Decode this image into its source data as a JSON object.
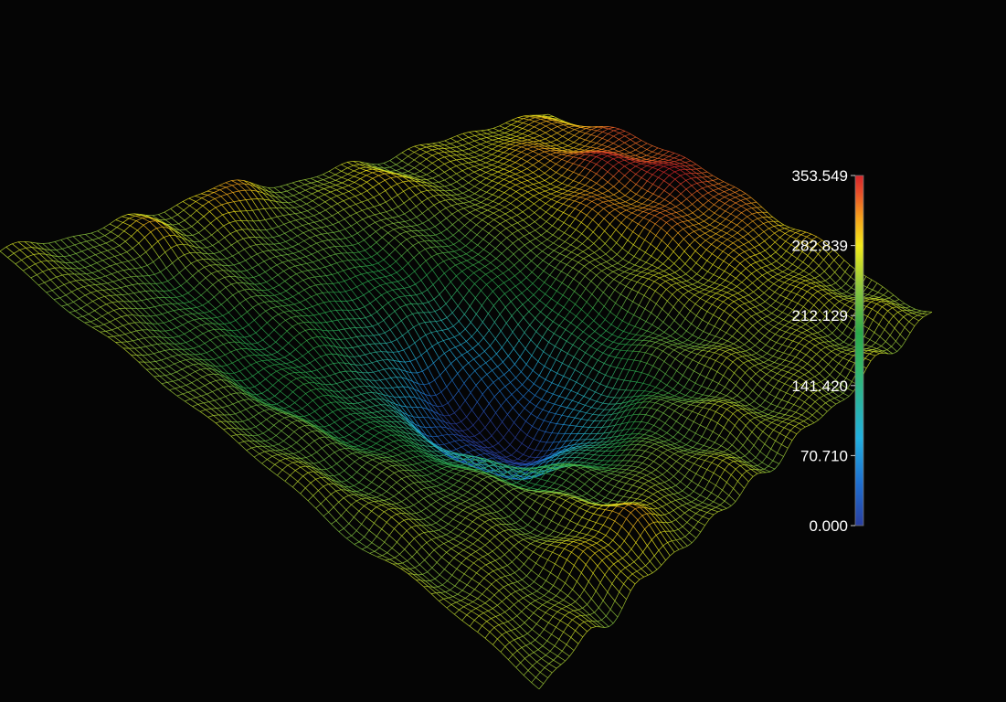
{
  "chart_data": {
    "type": "surface-wireframe",
    "title": "",
    "xlabel": "",
    "ylabel": "",
    "zlabel": "",
    "grid": false,
    "legend": "colorbar, right",
    "colorbar": {
      "min": 0.0,
      "max": 353.549,
      "ticks": [
        "353.549",
        "282.839",
        "212.129",
        "141.420",
        "70.710",
        "0.000"
      ],
      "tick_values": [
        353.549,
        282.839,
        212.129,
        141.42,
        70.71,
        0.0
      ],
      "colormap": [
        "#2a3fa0",
        "#1f6fd0",
        "#22b0e0",
        "#33b86a",
        "#2aa84a",
        "#8cc63f",
        "#f2ea1a",
        "#f7a21c",
        "#e9502a",
        "#d7262b"
      ]
    },
    "surface": {
      "description_values": "depth surface with central basin",
      "approx_min": 20,
      "approx_max": 353.549,
      "background": "#050505"
    }
  }
}
